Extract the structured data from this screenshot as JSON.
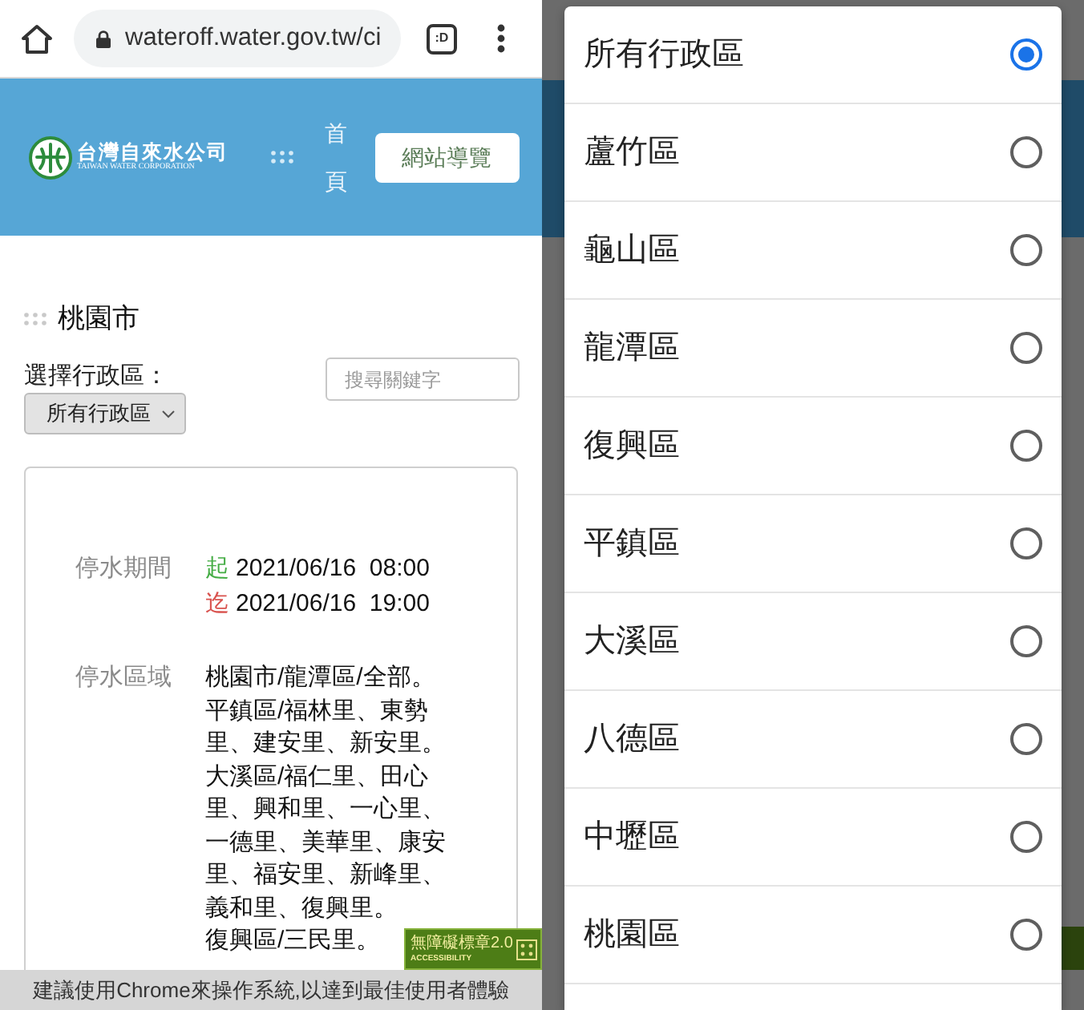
{
  "browser": {
    "url": "wateroff.water.gov.tw/ci",
    "tab_button": ":D"
  },
  "header": {
    "logo": {
      "name": "台灣自來水公司",
      "name_en": "TAIWAN WATER CORPORATION"
    },
    "home_link": "首頁",
    "sitemap_button": "網站導覽"
  },
  "page": {
    "title": "桃園市",
    "district_label": "選擇行政區：",
    "district_select": {
      "value": "所有行政區"
    },
    "search": {
      "placeholder": "搜尋關鍵字"
    },
    "notice": {
      "period_label": "停水期間",
      "period": [
        {
          "kind": "start",
          "marker": "起",
          "datetime": "2021/06/16  08:00"
        },
        {
          "kind": "end",
          "marker": "迄",
          "datetime": "2021/06/16  19:00"
        }
      ],
      "area_label": "停水區域",
      "areas": [
        "桃園市/龍潭區/全部。",
        "平鎮區/福林里、東勢里、建安里、新安里。",
        "大溪區/福仁里、田心里、興和里、一心里、一德里、美華里、康安里、福安里、新峰里、義和里、復興里。",
        "復興區/三民里。"
      ]
    }
  },
  "accessibility_badge": {
    "title": "無障礙標章2.0",
    "subtitle": "ACCESSIBILITY"
  },
  "footer": "建議使用Chrome來操作系統,以達到最佳使用者體驗",
  "district_dialog": {
    "options": [
      {
        "label": "所有行政區",
        "selected": true
      },
      {
        "label": "蘆竹區",
        "selected": false
      },
      {
        "label": "龜山區",
        "selected": false
      },
      {
        "label": "龍潭區",
        "selected": false
      },
      {
        "label": "復興區",
        "selected": false
      },
      {
        "label": "平鎮區",
        "selected": false
      },
      {
        "label": "大溪區",
        "selected": false
      },
      {
        "label": "八德區",
        "selected": false
      },
      {
        "label": "中壢區",
        "selected": false
      },
      {
        "label": "桃園區",
        "selected": false
      }
    ]
  }
}
